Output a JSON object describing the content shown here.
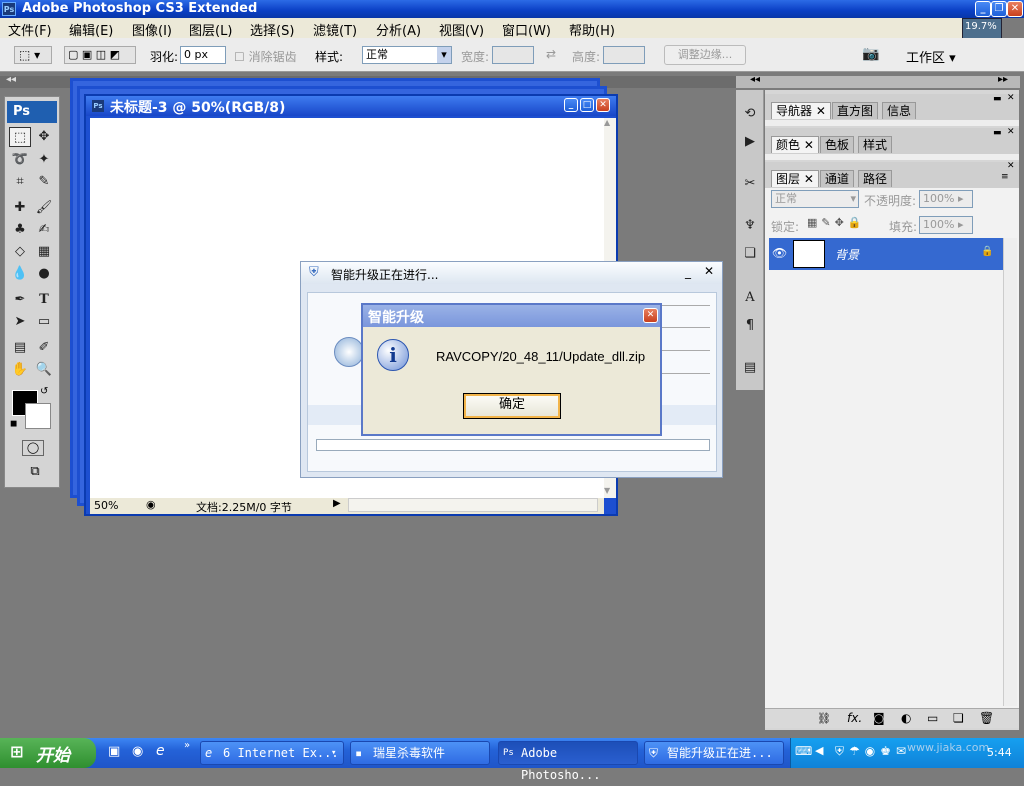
{
  "app_title": "Adobe Photoshop CS3 Extended",
  "ps_logo": "Ps",
  "zoom_thumb": "19.7%",
  "menu": [
    "文件(F)",
    "编辑(E)",
    "图像(I)",
    "图层(L)",
    "选择(S)",
    "滤镜(T)",
    "分析(A)",
    "视图(V)",
    "窗口(W)",
    "帮助(H)"
  ],
  "options": {
    "feather_label": "羽化:",
    "feather_value": "0 px",
    "antialias_label": "消除锯齿",
    "style_label": "样式:",
    "style_value": "正常",
    "width_label": "宽度:",
    "height_label": "高度:",
    "refine_label": "调整边缘...",
    "workspace_label": "工作区"
  },
  "document": {
    "title": "未标题-3 @ 50%(RGB/8)",
    "zoom": "50%",
    "doc_info": "文档:2.25M/0 字节"
  },
  "updater": {
    "title": "智能升级正在进行..."
  },
  "message": {
    "title": "智能升级",
    "text": "RAVCOPY/20_48_11/Update_dll.zip",
    "ok": "确定"
  },
  "panels": {
    "group1": [
      "导航器",
      "直方图",
      "信息"
    ],
    "group2": [
      "颜色",
      "色板",
      "样式"
    ],
    "group3": [
      "图层",
      "通道",
      "路径"
    ],
    "blend_mode": "正常",
    "opacity_label": "不透明度:",
    "opacity_value": "100%",
    "lock_label": "锁定:",
    "fill_label": "填充:",
    "fill_value": "100%",
    "layer_name": "背景"
  },
  "taskbar": {
    "start": "开始",
    "tasks": [
      "6 Internet Ex...",
      "瑞星杀毒软件",
      "Adobe Photosho...",
      "智能升级正在进..."
    ],
    "watermark": "www.jiaka.com",
    "clock": "5:44"
  }
}
